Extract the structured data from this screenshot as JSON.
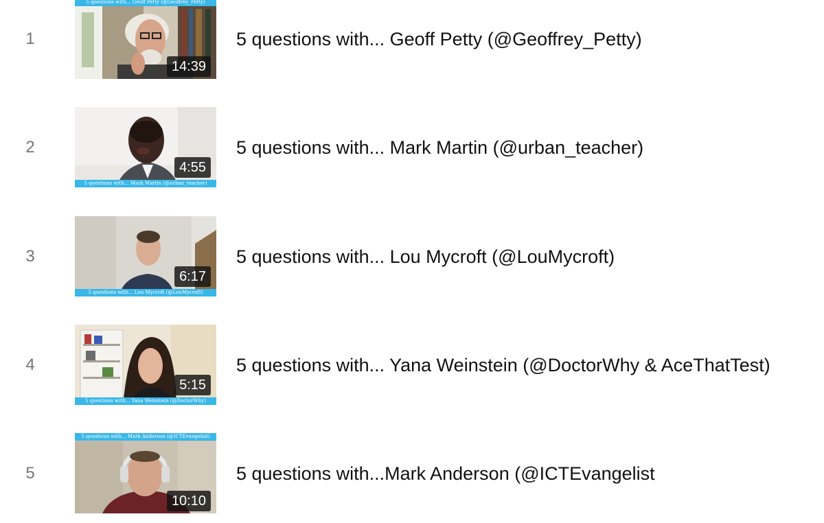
{
  "playlist": {
    "items": [
      {
        "index": "1",
        "title": "5 questions with... Geoff Petty (@Geoffrey_Petty)",
        "duration": "14:39",
        "thumb_caption": "5 questions with... Geoff Petty (@Geoffrey_Petty)"
      },
      {
        "index": "2",
        "title": "5 questions with... Mark Martin (@urban_teacher)",
        "duration": "4:55",
        "thumb_caption": "5 questions with... Mark Martin (@urban_teacher)"
      },
      {
        "index": "3",
        "title": "5 questions with... Lou Mycroft (@LouMycroft)",
        "duration": "6:17",
        "thumb_caption": "5 questions with... Lou Mycroft (@LouMycroft)"
      },
      {
        "index": "4",
        "title": "5 questions with... Yana Weinstein (@DoctorWhy & AceThatTest)",
        "duration": "5:15",
        "thumb_caption": "5 questions with... Yana Weinstein (@DoctorWhy)"
      },
      {
        "index": "5",
        "title": "5 questions with...Mark Anderson (@ICTEvangelist",
        "duration": "10:10",
        "thumb_caption": "5 questions with... Mark Anderson (@ICTEvangelist)"
      }
    ]
  },
  "colors": {
    "banner": "#39b7e8",
    "duration_bg": "#121212",
    "index_text": "#757575",
    "title_text": "#111111"
  }
}
